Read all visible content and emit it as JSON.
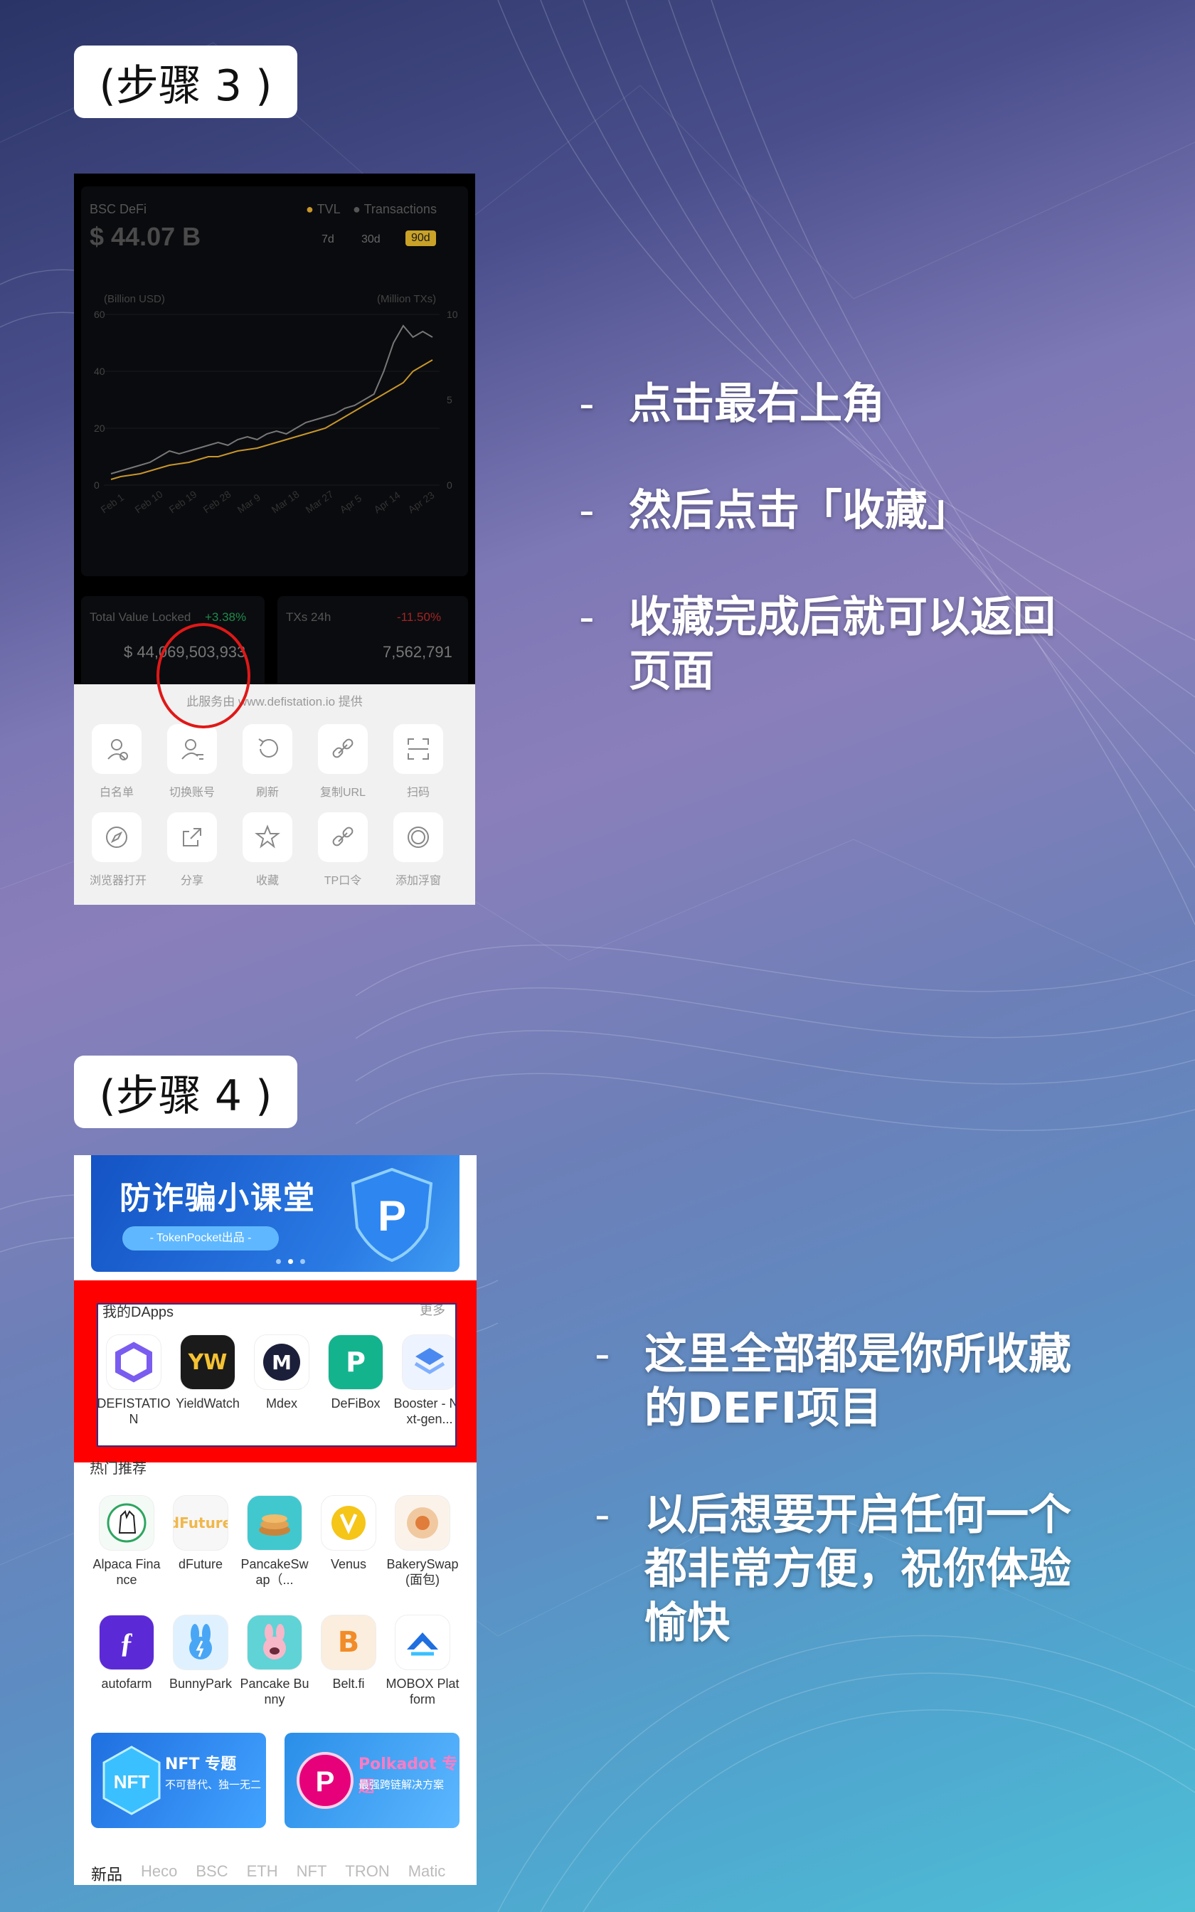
{
  "step3": {
    "label": "(步骤 3 )",
    "chart": {
      "title": "BSC DeFi",
      "value": "$ 44.07 B",
      "legend_tvl": "TVL",
      "legend_tx": "Transactions",
      "range_7d": "7d",
      "range_30d": "30d",
      "range_90d": "90d",
      "left_unit": "(Billion USD)",
      "right_unit": "(Million TXs)",
      "y_left": [
        "60",
        "40",
        "20",
        "0"
      ],
      "y_right": [
        "10",
        "5",
        "0"
      ],
      "x_ticks": [
        "Feb 1",
        "Feb 10",
        "Feb 19",
        "Feb 28",
        "Mar 9",
        "Mar 18",
        "Mar 27",
        "Apr 5",
        "Apr 14",
        "Apr 23"
      ]
    },
    "stats": {
      "tvl_label": "Total Value Locked",
      "tvl_change": "+3.38%",
      "tvl_value": "$ 44,069,503,933",
      "tx_label": "TXs 24h",
      "tx_change": "-11.50%",
      "tx_value": "7,562,791"
    },
    "sheet_note": "此服务由 www.defistation.io 提供",
    "tools_row1": [
      {
        "icon": "whitelist-user-icon",
        "label": "白名单"
      },
      {
        "icon": "switch-account-icon",
        "label": "切换账号"
      },
      {
        "icon": "refresh-icon",
        "label": "刷新"
      },
      {
        "icon": "link-icon",
        "label": "复制URL"
      },
      {
        "icon": "scan-icon",
        "label": "扫码"
      }
    ],
    "tools_row2": [
      {
        "icon": "compass-icon",
        "label": "浏览器打开"
      },
      {
        "icon": "share-icon",
        "label": "分享"
      },
      {
        "icon": "star-icon",
        "label": "收藏"
      },
      {
        "icon": "link-icon",
        "label": "TP口令"
      },
      {
        "icon": "floating-window-icon",
        "label": "添加浮窗"
      }
    ],
    "bullets": [
      "点击最右上角",
      "然后点击「收藏」",
      "收藏完成后就可以返回页面"
    ]
  },
  "step4": {
    "label": "(步骤 4 )",
    "banner_title": "防诈骗小课堂",
    "banner_sub": "- TokenPocket出品 -",
    "my_dapps_title": "我的DApps",
    "my_dapps_more": "更多",
    "my_dapps": [
      {
        "label": "DEFISTATION",
        "color": "#ffffff",
        "icon": "defistation-icon"
      },
      {
        "label": "YieldWatch",
        "color": "#1a1a1a",
        "icon": "yieldwatch-icon"
      },
      {
        "label": "Mdex",
        "color": "#ffffff",
        "icon": "mdex-icon"
      },
      {
        "label": "DeFiBox",
        "color": "#13b38e",
        "icon": "defibox-icon"
      },
      {
        "label": "Booster - Next-gen...",
        "color": "#eef4ff",
        "icon": "booster-icon"
      }
    ],
    "hot_title": "热门推荐",
    "hot_row1": [
      {
        "label": "Alpaca Finance",
        "color": "#f4fbf6",
        "icon": "alpaca-icon"
      },
      {
        "label": "dFuture",
        "color": "#f7f7f7",
        "icon": "dfuture-icon"
      },
      {
        "label": "PancakeSwap（...",
        "color": "#41c8cf",
        "icon": "pancakeswap-icon"
      },
      {
        "label": "Venus",
        "color": "#ffffff",
        "icon": "venus-icon"
      },
      {
        "label": "BakerySwap(面包)",
        "color": "#fbf3ea",
        "icon": "bakeryswap-icon"
      }
    ],
    "hot_row2": [
      {
        "label": "autofarm",
        "color": "#5b2ad6",
        "icon": "autofarm-icon"
      },
      {
        "label": "BunnyPark",
        "color": "#dff1ff",
        "icon": "bunnypark-icon"
      },
      {
        "label": "Pancake Bunny",
        "color": "#5fd3d6",
        "icon": "pancakebunny-icon"
      },
      {
        "label": "Belt.fi",
        "color": "#fbeede",
        "icon": "belt-icon"
      },
      {
        "label": "MOBOX Platform",
        "color": "#ffffff",
        "icon": "mobox-icon"
      }
    ],
    "promo_nft_title": "NFT 专题",
    "promo_nft_sub": "不可替代、独一无二",
    "promo_dot_title": "Polkadot 专题",
    "promo_dot_sub": "最强跨链解决方案",
    "tabs": [
      "新品",
      "Heco",
      "BSC",
      "ETH",
      "NFT",
      "TRON",
      "Matic"
    ],
    "bullets": [
      "这里全部都是你所收藏的DEFI项目",
      "以后想要开启任何一个都非常方便，祝你体验愉快"
    ]
  },
  "colors": {
    "tvl_line": "#c8962a",
    "tx_line": "#777777",
    "accent_red": "#ff0000",
    "badge_90d": "#c9a227"
  }
}
